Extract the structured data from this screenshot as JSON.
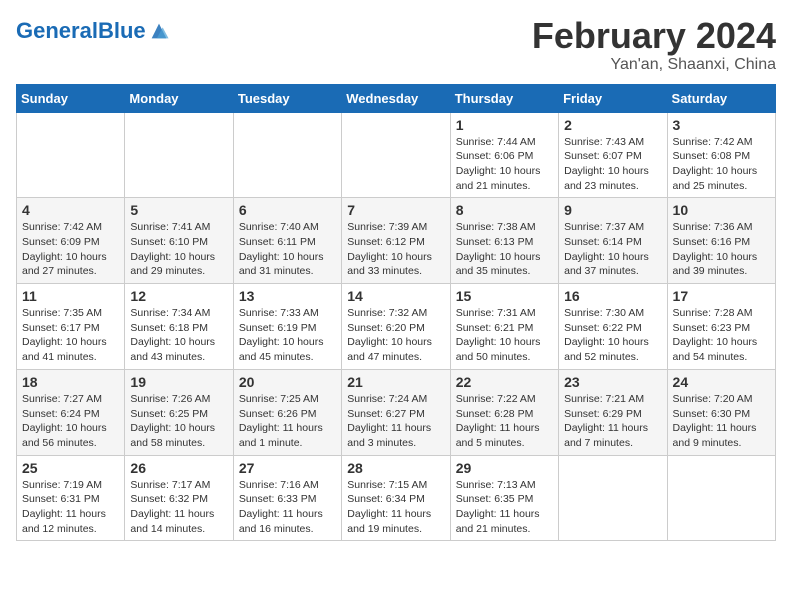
{
  "logo": {
    "part1": "General",
    "part2": "Blue"
  },
  "title": "February 2024",
  "location": "Yan'an, Shaanxi, China",
  "weekdays": [
    "Sunday",
    "Monday",
    "Tuesday",
    "Wednesday",
    "Thursday",
    "Friday",
    "Saturday"
  ],
  "weeks": [
    [
      {
        "day": "",
        "info": ""
      },
      {
        "day": "",
        "info": ""
      },
      {
        "day": "",
        "info": ""
      },
      {
        "day": "",
        "info": ""
      },
      {
        "day": "1",
        "info": "Sunrise: 7:44 AM\nSunset: 6:06 PM\nDaylight: 10 hours\nand 21 minutes."
      },
      {
        "day": "2",
        "info": "Sunrise: 7:43 AM\nSunset: 6:07 PM\nDaylight: 10 hours\nand 23 minutes."
      },
      {
        "day": "3",
        "info": "Sunrise: 7:42 AM\nSunset: 6:08 PM\nDaylight: 10 hours\nand 25 minutes."
      }
    ],
    [
      {
        "day": "4",
        "info": "Sunrise: 7:42 AM\nSunset: 6:09 PM\nDaylight: 10 hours\nand 27 minutes."
      },
      {
        "day": "5",
        "info": "Sunrise: 7:41 AM\nSunset: 6:10 PM\nDaylight: 10 hours\nand 29 minutes."
      },
      {
        "day": "6",
        "info": "Sunrise: 7:40 AM\nSunset: 6:11 PM\nDaylight: 10 hours\nand 31 minutes."
      },
      {
        "day": "7",
        "info": "Sunrise: 7:39 AM\nSunset: 6:12 PM\nDaylight: 10 hours\nand 33 minutes."
      },
      {
        "day": "8",
        "info": "Sunrise: 7:38 AM\nSunset: 6:13 PM\nDaylight: 10 hours\nand 35 minutes."
      },
      {
        "day": "9",
        "info": "Sunrise: 7:37 AM\nSunset: 6:14 PM\nDaylight: 10 hours\nand 37 minutes."
      },
      {
        "day": "10",
        "info": "Sunrise: 7:36 AM\nSunset: 6:16 PM\nDaylight: 10 hours\nand 39 minutes."
      }
    ],
    [
      {
        "day": "11",
        "info": "Sunrise: 7:35 AM\nSunset: 6:17 PM\nDaylight: 10 hours\nand 41 minutes."
      },
      {
        "day": "12",
        "info": "Sunrise: 7:34 AM\nSunset: 6:18 PM\nDaylight: 10 hours\nand 43 minutes."
      },
      {
        "day": "13",
        "info": "Sunrise: 7:33 AM\nSunset: 6:19 PM\nDaylight: 10 hours\nand 45 minutes."
      },
      {
        "day": "14",
        "info": "Sunrise: 7:32 AM\nSunset: 6:20 PM\nDaylight: 10 hours\nand 47 minutes."
      },
      {
        "day": "15",
        "info": "Sunrise: 7:31 AM\nSunset: 6:21 PM\nDaylight: 10 hours\nand 50 minutes."
      },
      {
        "day": "16",
        "info": "Sunrise: 7:30 AM\nSunset: 6:22 PM\nDaylight: 10 hours\nand 52 minutes."
      },
      {
        "day": "17",
        "info": "Sunrise: 7:28 AM\nSunset: 6:23 PM\nDaylight: 10 hours\nand 54 minutes."
      }
    ],
    [
      {
        "day": "18",
        "info": "Sunrise: 7:27 AM\nSunset: 6:24 PM\nDaylight: 10 hours\nand 56 minutes."
      },
      {
        "day": "19",
        "info": "Sunrise: 7:26 AM\nSunset: 6:25 PM\nDaylight: 10 hours\nand 58 minutes."
      },
      {
        "day": "20",
        "info": "Sunrise: 7:25 AM\nSunset: 6:26 PM\nDaylight: 11 hours\nand 1 minute."
      },
      {
        "day": "21",
        "info": "Sunrise: 7:24 AM\nSunset: 6:27 PM\nDaylight: 11 hours\nand 3 minutes."
      },
      {
        "day": "22",
        "info": "Sunrise: 7:22 AM\nSunset: 6:28 PM\nDaylight: 11 hours\nand 5 minutes."
      },
      {
        "day": "23",
        "info": "Sunrise: 7:21 AM\nSunset: 6:29 PM\nDaylight: 11 hours\nand 7 minutes."
      },
      {
        "day": "24",
        "info": "Sunrise: 7:20 AM\nSunset: 6:30 PM\nDaylight: 11 hours\nand 9 minutes."
      }
    ],
    [
      {
        "day": "25",
        "info": "Sunrise: 7:19 AM\nSunset: 6:31 PM\nDaylight: 11 hours\nand 12 minutes."
      },
      {
        "day": "26",
        "info": "Sunrise: 7:17 AM\nSunset: 6:32 PM\nDaylight: 11 hours\nand 14 minutes."
      },
      {
        "day": "27",
        "info": "Sunrise: 7:16 AM\nSunset: 6:33 PM\nDaylight: 11 hours\nand 16 minutes."
      },
      {
        "day": "28",
        "info": "Sunrise: 7:15 AM\nSunset: 6:34 PM\nDaylight: 11 hours\nand 19 minutes."
      },
      {
        "day": "29",
        "info": "Sunrise: 7:13 AM\nSunset: 6:35 PM\nDaylight: 11 hours\nand 21 minutes."
      },
      {
        "day": "",
        "info": ""
      },
      {
        "day": "",
        "info": ""
      }
    ]
  ]
}
